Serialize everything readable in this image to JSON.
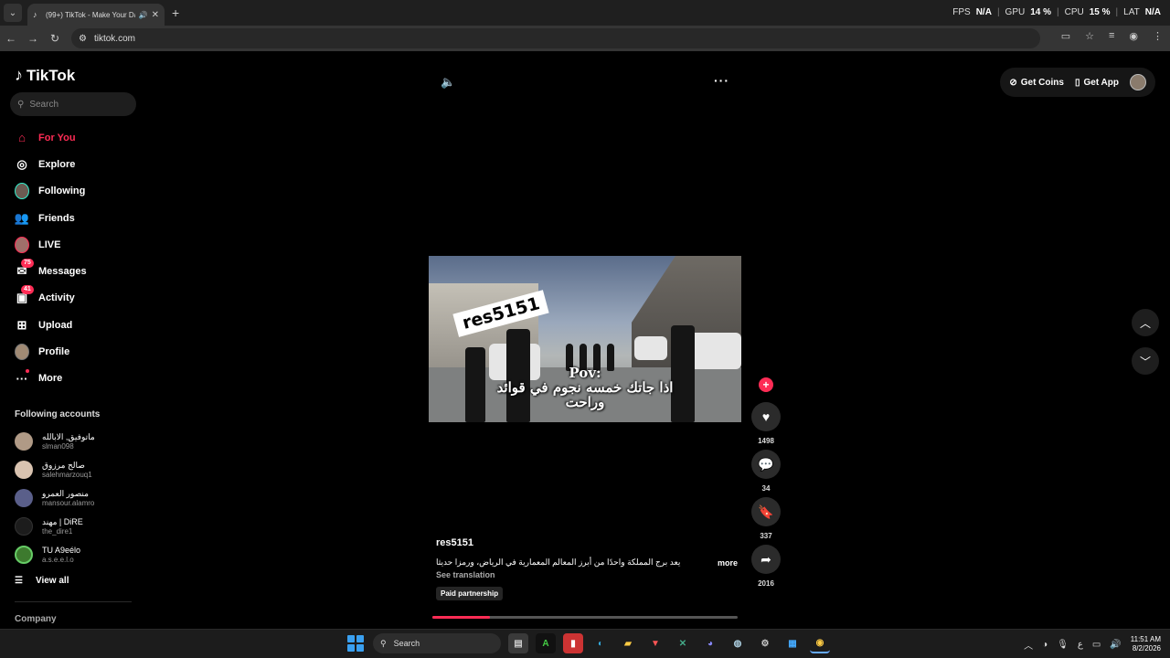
{
  "browser": {
    "tab_title": "(99+) TikTok - Make Your Day",
    "url": "tiktok.com",
    "stats": [
      {
        "label": "FPS",
        "value": "N/A"
      },
      {
        "label": "GPU",
        "value": "14 %"
      },
      {
        "label": "CPU",
        "value": "15 %"
      },
      {
        "label": "LAT",
        "value": "N/A"
      }
    ]
  },
  "sidebar": {
    "logo": "TikTok",
    "search_placeholder": "Search",
    "nav": [
      {
        "label": "For You",
        "icon": "home-icon",
        "active": true
      },
      {
        "label": "Explore",
        "icon": "compass-icon"
      },
      {
        "label": "Following",
        "icon": "following-avatar-icon"
      },
      {
        "label": "Friends",
        "icon": "friends-icon"
      },
      {
        "label": "LIVE",
        "icon": "live-avatar-icon"
      },
      {
        "label": "Messages",
        "icon": "messages-icon",
        "badge": "75"
      },
      {
        "label": "Activity",
        "icon": "activity-icon",
        "badge": "41"
      },
      {
        "label": "Upload",
        "icon": "upload-icon"
      },
      {
        "label": "Profile",
        "icon": "profile-avatar-icon"
      },
      {
        "label": "More",
        "icon": "more-icon"
      }
    ],
    "following_title": "Following accounts",
    "following": [
      {
        "name": "ماتوفيق, الابالله",
        "user": "slman098"
      },
      {
        "name": "صالح مرزوق",
        "user": "salehmarzouq1"
      },
      {
        "name": "منصور العمرو",
        "user": "mansour.alamro"
      },
      {
        "name": "مهند | DiRE",
        "user": "the_dire1"
      },
      {
        "name": "TU A9eélo",
        "user": "a.s.e.e.l.o"
      }
    ],
    "view_all": "View all",
    "company": "Company"
  },
  "topbar": {
    "get_coins": "Get Coins",
    "get_app": "Get App"
  },
  "video": {
    "sticker": "res5151",
    "caption_line1": "Pov:",
    "caption_line2": "اذا جاتك خمسه نجوم في قوائد",
    "caption_line3": "وراحت",
    "author": "res5151",
    "description": "يعد برج المملكة واحدًا من أبرز المعالم المعمارية في الرياض، ورمزا حديثا",
    "more": "more",
    "see_translation": "See translation",
    "paid": "Paid partnership",
    "progress": 0.19,
    "likes": "1498",
    "comments": "34",
    "saves": "337",
    "shares": "2016"
  },
  "taskbar": {
    "search": "Search",
    "time": "11:51 AM",
    "date": "8/2/2026"
  },
  "colors": {
    "accent": "#fe2c55"
  }
}
